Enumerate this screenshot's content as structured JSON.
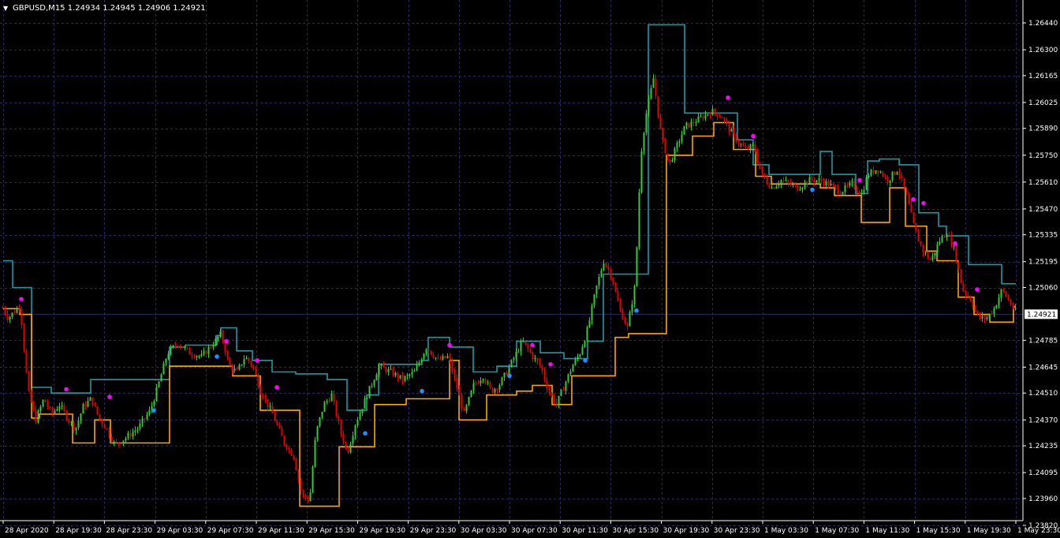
{
  "header": {
    "collapse_glyph": "▼",
    "title": "GBPUSD,M15  1.24934 1.24945 1.24906 1.24921"
  },
  "colors": {
    "background": "#000000",
    "grid": "#2a2a55",
    "axis": "#ffffff",
    "bull": "#33cc33",
    "bear": "#e60000",
    "upper_band": "#21999f",
    "lower_band": "#ffa500",
    "dot_up": "#1e90ff",
    "dot_down": "#ff00ff",
    "price_line": "#2a2a66",
    "price_tag_bg": "#ffffff",
    "price_tag_text": "#000000"
  },
  "chart_data": {
    "type": "candlestick",
    "symbol": "GBPUSD",
    "timeframe": "M15",
    "ohlc_current": {
      "open": 1.24934,
      "high": 1.24945,
      "low": 1.24906,
      "close": 1.24921
    },
    "current_price_label": "1.24921",
    "y_ticks": [
      "1.26440",
      "1.26300",
      "1.26165",
      "1.26025",
      "1.25890",
      "1.25750",
      "1.25610",
      "1.25470",
      "1.25335",
      "1.25195",
      "1.25060",
      "1.24785",
      "1.24645",
      "1.24510",
      "1.24370",
      "1.24235",
      "1.24095",
      "1.23960",
      "1.23820"
    ],
    "ylim": [
      1.2382,
      1.2651
    ],
    "x_ticks": [
      "28 Apr 2020",
      "28 Apr 19:30",
      "28 Apr 23:30",
      "29 Apr 03:30",
      "29 Apr 07:30",
      "29 Apr 11:30",
      "29 Apr 15:30",
      "29 Apr 19:30",
      "29 Apr 23:30",
      "30 Apr 03:30",
      "30 Apr 07:30",
      "30 Apr 11:30",
      "30 Apr 15:30",
      "30 Apr 19:30",
      "30 Apr 23:30",
      "1 May 03:30",
      "1 May 07:30",
      "1 May 11:30",
      "1 May 15:30",
      "1 May 19:30",
      "1 May 23:30"
    ],
    "price_path": [
      [
        0,
        1.2498
      ],
      [
        10,
        1.249
      ],
      [
        25,
        1.2497
      ],
      [
        35,
        1.2452
      ],
      [
        45,
        1.2437
      ],
      [
        55,
        1.2448
      ],
      [
        65,
        1.244
      ],
      [
        75,
        1.2445
      ],
      [
        85,
        1.2438
      ],
      [
        95,
        1.2432
      ],
      [
        105,
        1.2444
      ],
      [
        115,
        1.2448
      ],
      [
        125,
        1.2438
      ],
      [
        135,
        1.2432
      ],
      [
        145,
        1.2424
      ],
      [
        160,
        1.2428
      ],
      [
        175,
        1.2433
      ],
      [
        190,
        1.2442
      ],
      [
        200,
        1.2455
      ],
      [
        212,
        1.2472
      ],
      [
        225,
        1.2477
      ],
      [
        240,
        1.2472
      ],
      [
        255,
        1.247
      ],
      [
        270,
        1.2477
      ],
      [
        280,
        1.2482
      ],
      [
        290,
        1.2465
      ],
      [
        300,
        1.2462
      ],
      [
        310,
        1.247
      ],
      [
        320,
        1.2465
      ],
      [
        330,
        1.2452
      ],
      [
        345,
        1.244
      ],
      [
        360,
        1.2425
      ],
      [
        372,
        1.2418
      ],
      [
        382,
        1.2398
      ],
      [
        392,
        1.2395
      ],
      [
        400,
        1.243
      ],
      [
        410,
        1.2445
      ],
      [
        420,
        1.245
      ],
      [
        432,
        1.243
      ],
      [
        440,
        1.242
      ],
      [
        450,
        1.2435
      ],
      [
        460,
        1.2445
      ],
      [
        470,
        1.2455
      ],
      [
        480,
        1.2465
      ],
      [
        495,
        1.2462
      ],
      [
        510,
        1.2458
      ],
      [
        525,
        1.2462
      ],
      [
        540,
        1.2475
      ],
      [
        555,
        1.2468
      ],
      [
        568,
        1.247
      ],
      [
        578,
        1.2455
      ],
      [
        588,
        1.244
      ],
      [
        600,
        1.2455
      ],
      [
        612,
        1.246
      ],
      [
        622,
        1.2452
      ],
      [
        632,
        1.2455
      ],
      [
        642,
        1.2462
      ],
      [
        652,
        1.247
      ],
      [
        662,
        1.2478
      ],
      [
        675,
        1.247
      ],
      [
        685,
        1.2465
      ],
      [
        695,
        1.2452
      ],
      [
        705,
        1.2445
      ],
      [
        715,
        1.2455
      ],
      [
        725,
        1.2465
      ],
      [
        735,
        1.2472
      ],
      [
        745,
        1.2485
      ],
      [
        755,
        1.2505
      ],
      [
        765,
        1.252
      ],
      [
        775,
        1.2512
      ],
      [
        785,
        1.2495
      ],
      [
        795,
        1.2485
      ],
      [
        805,
        1.2508
      ],
      [
        812,
        1.2575
      ],
      [
        818,
        1.2595
      ],
      [
        828,
        1.2615
      ],
      [
        838,
        1.2585
      ],
      [
        848,
        1.257
      ],
      [
        858,
        1.258
      ],
      [
        868,
        1.259
      ],
      [
        878,
        1.2592
      ],
      [
        890,
        1.2595
      ],
      [
        902,
        1.2598
      ],
      [
        915,
        1.2595
      ],
      [
        925,
        1.2588
      ],
      [
        935,
        1.2582
      ],
      [
        945,
        1.2578
      ],
      [
        955,
        1.258
      ],
      [
        965,
        1.2565
      ],
      [
        978,
        1.2558
      ],
      [
        990,
        1.2562
      ],
      [
        1000,
        1.256
      ],
      [
        1012,
        1.2558
      ],
      [
        1025,
        1.2562
      ],
      [
        1038,
        1.2562
      ],
      [
        1050,
        1.256
      ],
      [
        1065,
        1.2556
      ],
      [
        1080,
        1.256
      ],
      [
        1092,
        1.2555
      ],
      [
        1100,
        1.2565
      ],
      [
        1112,
        1.2568
      ],
      [
        1125,
        1.2562
      ],
      [
        1138,
        1.2568
      ],
      [
        1150,
        1.2552
      ],
      [
        1160,
        1.2535
      ],
      [
        1170,
        1.2525
      ],
      [
        1180,
        1.252
      ],
      [
        1190,
        1.253
      ],
      [
        1200,
        1.2535
      ],
      [
        1210,
        1.2525
      ],
      [
        1220,
        1.2505
      ],
      [
        1230,
        1.25
      ],
      [
        1240,
        1.249
      ],
      [
        1250,
        1.249
      ],
      [
        1260,
        1.2495
      ],
      [
        1270,
        1.2505
      ],
      [
        1280,
        1.2498
      ],
      [
        1288,
        1.2493
      ]
    ],
    "upper_band": [
      [
        4,
        1.252
      ],
      [
        16,
        1.252
      ],
      [
        16,
        1.2506
      ],
      [
        40,
        1.2506
      ],
      [
        40,
        1.2454
      ],
      [
        65,
        1.2454
      ],
      [
        65,
        1.2451
      ],
      [
        115,
        1.2451
      ],
      [
        115,
        1.2458
      ],
      [
        215,
        1.2458
      ],
      [
        215,
        1.2475
      ],
      [
        235,
        1.2475
      ],
      [
        235,
        1.2476
      ],
      [
        275,
        1.2476
      ],
      [
        275,
        1.2481
      ],
      [
        280,
        1.2481
      ],
      [
        280,
        1.2485
      ],
      [
        300,
        1.2485
      ],
      [
        300,
        1.2473
      ],
      [
        320,
        1.2473
      ],
      [
        320,
        1.2468
      ],
      [
        345,
        1.2468
      ],
      [
        345,
        1.2462
      ],
      [
        375,
        1.2462
      ],
      [
        375,
        1.2461
      ],
      [
        415,
        1.2461
      ],
      [
        415,
        1.2458
      ],
      [
        440,
        1.2458
      ],
      [
        440,
        1.2442
      ],
      [
        465,
        1.2442
      ],
      [
        465,
        1.245
      ],
      [
        480,
        1.245
      ],
      [
        480,
        1.2466
      ],
      [
        535,
        1.2466
      ],
      [
        535,
        1.2468
      ],
      [
        543,
        1.2468
      ],
      [
        543,
        1.248
      ],
      [
        570,
        1.248
      ],
      [
        570,
        1.2475
      ],
      [
        600,
        1.2475
      ],
      [
        600,
        1.2462
      ],
      [
        630,
        1.2462
      ],
      [
        630,
        1.2465
      ],
      [
        655,
        1.2465
      ],
      [
        655,
        1.2478
      ],
      [
        685,
        1.2478
      ],
      [
        685,
        1.2472
      ],
      [
        715,
        1.2472
      ],
      [
        715,
        1.2469
      ],
      [
        745,
        1.2469
      ],
      [
        745,
        1.2478
      ],
      [
        765,
        1.2478
      ],
      [
        765,
        1.2513
      ],
      [
        822,
        1.2513
      ],
      [
        822,
        1.2643
      ],
      [
        868,
        1.2643
      ],
      [
        868,
        1.2597
      ],
      [
        935,
        1.2597
      ],
      [
        935,
        1.2583
      ],
      [
        955,
        1.2583
      ],
      [
        955,
        1.257
      ],
      [
        975,
        1.257
      ],
      [
        975,
        1.2565
      ],
      [
        1040,
        1.2565
      ],
      [
        1040,
        1.2577
      ],
      [
        1055,
        1.2577
      ],
      [
        1055,
        1.2565
      ],
      [
        1085,
        1.2565
      ],
      [
        1085,
        1.2555
      ],
      [
        1100,
        1.2555
      ],
      [
        1100,
        1.2572
      ],
      [
        1115,
        1.2572
      ],
      [
        1115,
        1.2573
      ],
      [
        1140,
        1.2573
      ],
      [
        1140,
        1.257
      ],
      [
        1165,
        1.257
      ],
      [
        1165,
        1.2545
      ],
      [
        1190,
        1.2545
      ],
      [
        1190,
        1.2538
      ],
      [
        1200,
        1.2538
      ],
      [
        1200,
        1.2533
      ],
      [
        1228,
        1.2533
      ],
      [
        1228,
        1.2518
      ],
      [
        1270,
        1.2518
      ],
      [
        1270,
        1.2508
      ],
      [
        1288,
        1.2508
      ]
    ],
    "lower_band": [
      [
        4,
        1.2495
      ],
      [
        25,
        1.2495
      ],
      [
        25,
        1.2492
      ],
      [
        40,
        1.2492
      ],
      [
        40,
        1.2438
      ],
      [
        50,
        1.2438
      ],
      [
        50,
        1.244
      ],
      [
        92,
        1.244
      ],
      [
        92,
        1.2425
      ],
      [
        120,
        1.2425
      ],
      [
        120,
        1.2437
      ],
      [
        140,
        1.2437
      ],
      [
        140,
        1.2425
      ],
      [
        215,
        1.2425
      ],
      [
        215,
        1.2465
      ],
      [
        295,
        1.2465
      ],
      [
        295,
        1.246
      ],
      [
        330,
        1.246
      ],
      [
        330,
        1.2442
      ],
      [
        380,
        1.2442
      ],
      [
        380,
        1.2392
      ],
      [
        430,
        1.2392
      ],
      [
        430,
        1.2423
      ],
      [
        475,
        1.2423
      ],
      [
        475,
        1.2445
      ],
      [
        515,
        1.2445
      ],
      [
        515,
        1.2448
      ],
      [
        570,
        1.2448
      ],
      [
        570,
        1.2468
      ],
      [
        582,
        1.2468
      ],
      [
        582,
        1.2437
      ],
      [
        617,
        1.2437
      ],
      [
        617,
        1.245
      ],
      [
        655,
        1.245
      ],
      [
        655,
        1.2452
      ],
      [
        675,
        1.2452
      ],
      [
        675,
        1.2455
      ],
      [
        700,
        1.2455
      ],
      [
        700,
        1.2445
      ],
      [
        725,
        1.2445
      ],
      [
        725,
        1.246
      ],
      [
        780,
        1.246
      ],
      [
        780,
        1.248
      ],
      [
        797,
        1.248
      ],
      [
        797,
        1.2482
      ],
      [
        845,
        1.2482
      ],
      [
        845,
        1.2575
      ],
      [
        878,
        1.2575
      ],
      [
        878,
        1.2585
      ],
      [
        905,
        1.2585
      ],
      [
        905,
        1.2592
      ],
      [
        930,
        1.2592
      ],
      [
        930,
        1.2578
      ],
      [
        958,
        1.2578
      ],
      [
        958,
        1.2564
      ],
      [
        978,
        1.2564
      ],
      [
        978,
        1.256
      ],
      [
        1040,
        1.256
      ],
      [
        1040,
        1.2558
      ],
      [
        1058,
        1.2558
      ],
      [
        1058,
        1.2554
      ],
      [
        1092,
        1.2554
      ],
      [
        1092,
        1.254
      ],
      [
        1128,
        1.254
      ],
      [
        1128,
        1.2558
      ],
      [
        1148,
        1.2558
      ],
      [
        1148,
        1.2538
      ],
      [
        1175,
        1.2538
      ],
      [
        1175,
        1.2525
      ],
      [
        1188,
        1.2525
      ],
      [
        1188,
        1.252
      ],
      [
        1215,
        1.252
      ],
      [
        1215,
        1.2501
      ],
      [
        1235,
        1.2501
      ],
      [
        1235,
        1.2492
      ],
      [
        1255,
        1.2492
      ],
      [
        1255,
        1.2488
      ],
      [
        1285,
        1.2488
      ],
      [
        1285,
        1.2496
      ],
      [
        1288,
        1.2496
      ]
    ],
    "signal_dots_up": [
      [
        195,
        1.2442
      ],
      [
        275,
        1.247
      ],
      [
        463,
        1.243
      ],
      [
        535,
        1.2452
      ],
      [
        646,
        1.246
      ],
      [
        742,
        1.2468
      ],
      [
        807,
        1.2494
      ],
      [
        1030,
        1.2557
      ]
    ],
    "signal_dots_down": [
      [
        27,
        1.25
      ],
      [
        84,
        1.2453
      ],
      [
        139,
        1.2449
      ],
      [
        287,
        1.2478
      ],
      [
        326,
        1.2468
      ],
      [
        351,
        1.2454
      ],
      [
        570,
        1.2476
      ],
      [
        675,
        1.2476
      ],
      [
        698,
        1.2466
      ],
      [
        923,
        1.2605
      ],
      [
        955,
        1.2585
      ],
      [
        1090,
        1.2562
      ],
      [
        1158,
        1.2552
      ],
      [
        1171,
        1.255
      ],
      [
        1211,
        1.2529
      ],
      [
        1239,
        1.2505
      ]
    ]
  }
}
